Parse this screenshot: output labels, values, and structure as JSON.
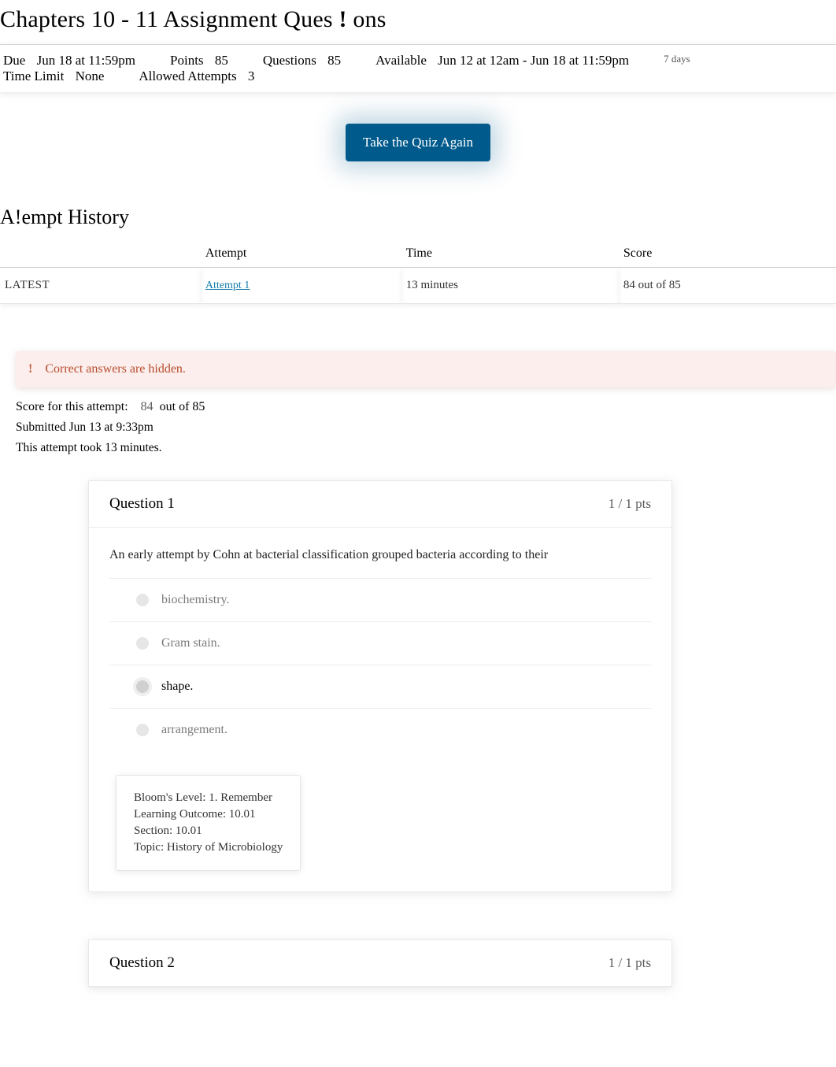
{
  "page": {
    "title_prefix": "Chapters 10 - 11 Assignment Ques",
    "title_suffix": "ons",
    "chevron": "!"
  },
  "meta": {
    "due_label": "Due",
    "due_value": "Jun 18 at 11:59pm",
    "points_label": "Points",
    "points_value": "85",
    "questions_label": "Questions",
    "questions_value": "85",
    "available_label": "Available",
    "available_value": "Jun 12 at 12am - Jun 18 at 11:59pm",
    "available_days": "7 days",
    "timelimit_label": "Time Limit",
    "timelimit_value": "None",
    "allowed_label": "Allowed Attempts",
    "allowed_value": "3"
  },
  "take_again_button": "Take the Quiz Again",
  "history": {
    "heading_prefix": "A",
    "heading_bang": "!",
    "heading_suffix": "empt History",
    "headers": {
      "attempt": "Attempt",
      "time": "Time",
      "score": "Score"
    },
    "row": {
      "latest": "LATEST",
      "attempt_link": "Attempt 1",
      "time": "13 minutes",
      "score": "84 out of 85"
    }
  },
  "hidden_banner": "Correct answers are hidden.",
  "score_line": {
    "label": "Score for this attempt:",
    "value": "84",
    "suffix": "out of 85"
  },
  "submitted_line": "Submitted Jun 13 at 9:33pm",
  "took_line": "This attempt took 13 minutes.",
  "q1": {
    "title": "Question 1",
    "pts": "1 / 1 pts",
    "prompt": "An early attempt by Cohn at bacterial classification grouped bacteria according to their",
    "answers": [
      {
        "text": "biochemistry.",
        "selected": false,
        "dim": true
      },
      {
        "text": "Gram stain.",
        "selected": false,
        "dim": true
      },
      {
        "text": "shape.",
        "selected": true,
        "dim": false
      },
      {
        "text": "arrangement.",
        "selected": false,
        "dim": true
      }
    ],
    "meta": [
      "Bloom's Level: 1. Remember",
      "Learning Outcome: 10.01",
      "Section: 10.01",
      "Topic: History of Microbiology"
    ]
  },
  "q2": {
    "title": "Question 2",
    "pts": "1 / 1 pts"
  }
}
